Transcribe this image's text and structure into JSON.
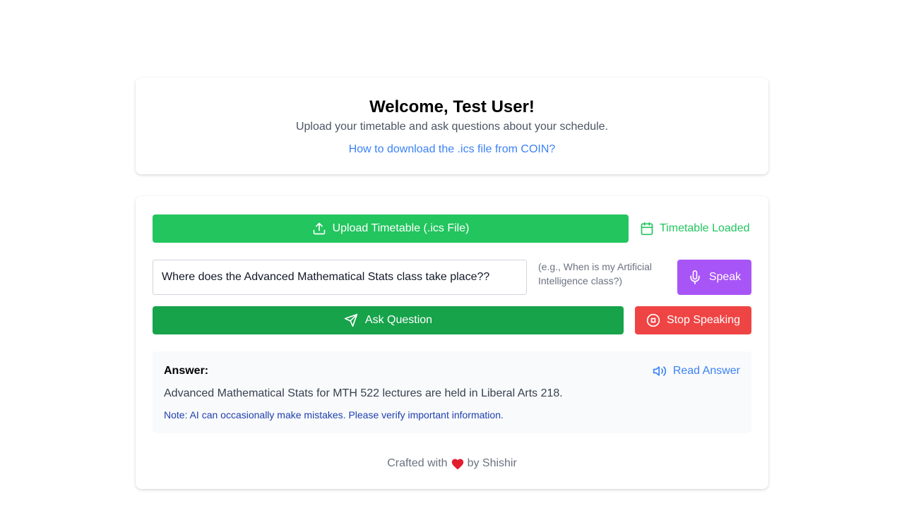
{
  "welcome": {
    "title": "Welcome, Test User!",
    "subtitle": "Upload your timetable and ask questions about your schedule.",
    "help_link": "How to download the .ics file from COIN?"
  },
  "upload": {
    "label": "Upload Timetable (.ics File)",
    "icon": "upload-icon",
    "status": "Timetable Loaded",
    "status_icon": "calendar-icon"
  },
  "question": {
    "value": "Where does the Advanced Mathematical Stats class take place??",
    "hint": "(e.g., When is my Artificial Intelligence class?)"
  },
  "buttons": {
    "speak": "Speak",
    "ask": "Ask Question",
    "stop": "Stop Speaking"
  },
  "answer": {
    "label": "Answer:",
    "read_label": "Read Answer",
    "text": "Advanced Mathematical Stats for MTH 522 lectures are held in Liberal Arts 218.",
    "note": "Note: AI can occasionally make mistakes. Please verify important information."
  },
  "footer": {
    "prefix": "Crafted with",
    "suffix": "by Shishir"
  },
  "colors": {
    "upload": "#22c55e",
    "ask": "#16a34a",
    "speak": "#a855f7",
    "stop": "#ef4444",
    "link": "#3b82f6"
  }
}
